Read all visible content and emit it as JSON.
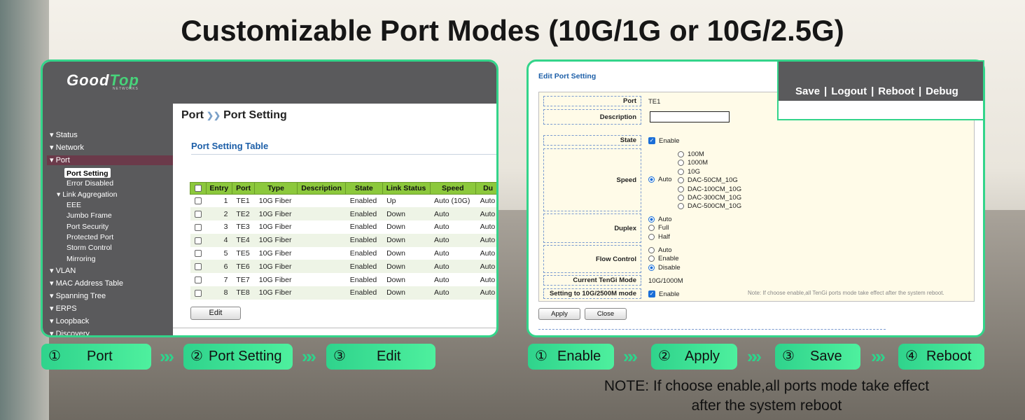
{
  "headline": "Customizable Port Modes (10G/1G or 10G/2.5G)",
  "left_panel": {
    "logo_main": "Good",
    "logo_accent": "Top",
    "logo_sub": "NETWORKS",
    "sidebar": {
      "items": [
        {
          "label": "Status",
          "arrow": "▾"
        },
        {
          "label": "Network",
          "arrow": "▾"
        },
        {
          "label": "Port",
          "arrow": "▾"
        },
        {
          "label": "VLAN",
          "arrow": "▾"
        },
        {
          "label": "MAC Address Table",
          "arrow": "▾"
        },
        {
          "label": "Spanning Tree",
          "arrow": "▾"
        },
        {
          "label": "ERPS",
          "arrow": "▾"
        },
        {
          "label": "Loopback",
          "arrow": "▾"
        },
        {
          "label": "Discovery",
          "arrow": "▾"
        }
      ],
      "port_children": [
        "Port Setting",
        "Error Disabled",
        "Link Aggregation",
        "EEE",
        "Jumbo Frame",
        "Port Security",
        "Protected Port",
        "Storm Control",
        "Mirroring"
      ],
      "link_agg_arrow": "▾"
    },
    "breadcrumb": {
      "root": "Port",
      "sep": "❯❯",
      "current": "Port Setting"
    },
    "table_title": "Port Setting Table",
    "columns": [
      "Entry",
      "Port",
      "Type",
      "Description",
      "State",
      "Link Status",
      "Speed",
      "Du"
    ],
    "rows": [
      [
        "1",
        "TE1",
        "10G Fiber",
        "",
        "Enabled",
        "Up",
        "Auto (10G)",
        "Auto"
      ],
      [
        "2",
        "TE2",
        "10G Fiber",
        "",
        "Enabled",
        "Down",
        "Auto",
        "Auto"
      ],
      [
        "3",
        "TE3",
        "10G Fiber",
        "",
        "Enabled",
        "Down",
        "Auto",
        "Auto"
      ],
      [
        "4",
        "TE4",
        "10G Fiber",
        "",
        "Enabled",
        "Down",
        "Auto",
        "Auto"
      ],
      [
        "5",
        "TE5",
        "10G Fiber",
        "",
        "Enabled",
        "Down",
        "Auto",
        "Auto"
      ],
      [
        "6",
        "TE6",
        "10G Fiber",
        "",
        "Enabled",
        "Down",
        "Auto",
        "Auto"
      ],
      [
        "7",
        "TE7",
        "10G Fiber",
        "",
        "Enabled",
        "Down",
        "Auto",
        "Auto"
      ],
      [
        "8",
        "TE8",
        "10G Fiber",
        "",
        "Enabled",
        "Down",
        "Auto",
        "Auto"
      ]
    ],
    "edit_label": "Edit"
  },
  "right_panel": {
    "title": "Edit Port Setting",
    "labels": {
      "port": "Port",
      "description": "Description",
      "state": "State",
      "speed": "Speed",
      "duplex": "Duplex",
      "flow_control": "Flow Control",
      "current_mode": "Current TenGi Mode",
      "setting_mode": "Setting to 10G/2500M mode"
    },
    "port_value": "TE1",
    "state_option": "Enable",
    "speed_auto": "Auto",
    "speed_options": [
      "100M",
      "1000M",
      "10G",
      "DAC-50CM_10G",
      "DAC-100CM_10G",
      "DAC-300CM_10G",
      "DAC-500CM_10G"
    ],
    "duplex_options": [
      "Auto",
      "Full",
      "Half"
    ],
    "duplex_selected": "Auto",
    "flow_options": [
      "Auto",
      "Enable",
      "Disable"
    ],
    "flow_selected": "Disable",
    "current_mode_value": "10G/1000M",
    "setting_mode_option": "Enable",
    "setting_note": "Note: If choose enable,all TenGi ports mode take effect after the system reboot.",
    "apply_label": "Apply",
    "close_label": "Close",
    "check_glyph": "✓"
  },
  "top_links": [
    "Save",
    "Logout",
    "Reboot",
    "Debug"
  ],
  "top_link_sep": "|",
  "steps_left": [
    {
      "num": "①",
      "label": "Port"
    },
    {
      "num": "②",
      "label": "Port Setting"
    },
    {
      "num": "③",
      "label": "Edit"
    }
  ],
  "steps_right": [
    {
      "num": "①",
      "label": "Enable"
    },
    {
      "num": "②",
      "label": "Apply"
    },
    {
      "num": "③",
      "label": "Save"
    },
    {
      "num": "④",
      "label": "Reboot"
    }
  ],
  "chevron": "»",
  "note_line1": "NOTE: If choose enable,all ports mode take effect",
  "note_line2": "after the system reboot",
  "colors": {
    "accent": "#33d48a",
    "table_header": "#8cc83c",
    "title_blue": "#1d5fa8",
    "sidebar": "#5a5a5c"
  }
}
